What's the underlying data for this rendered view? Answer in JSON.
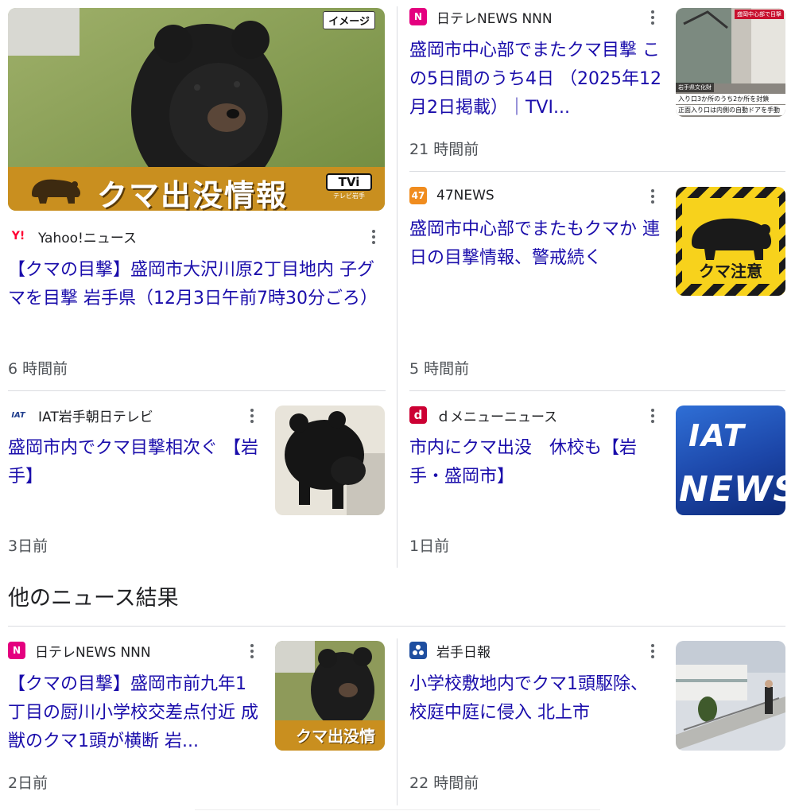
{
  "top_stories": [
    {
      "source": "Yahoo!ニュース",
      "favicon": {
        "icon": "yahoo-icon",
        "text": "Y!",
        "color": "#ff0033"
      },
      "title": "【クマの目撃】盛岡市大沢川原2丁目地内 子グマを目撃 岩手県（12月3日午前7時30分ごろ）",
      "time": "6 時間前",
      "thumb": {
        "badge": "イメージ",
        "banner": "クマ出没情報",
        "logo_top": "TVi",
        "logo_bottom": "テレビ岩手"
      }
    },
    {
      "source": "日テレNEWS NNN",
      "favicon": {
        "icon": "nnn-icon",
        "text": "N",
        "color": "#e4007f"
      },
      "title": "盛岡市中心部でまたクマ目撃 この5日間のうち4日 （2025年12月2日掲載）｜TVI...",
      "time": "21 時間前",
      "thumb": {
        "caption1": "盛岡中心部で目撃",
        "caption2": "入り口3か所のうち2か所を封鎖",
        "caption3": "正面入り口は内側の自動ドアを手動",
        "caption4": "岩手県文化財"
      }
    },
    {
      "source": "47NEWS",
      "favicon": {
        "icon": "47news-icon",
        "text": "47",
        "color": "#f08c1e"
      },
      "title": "盛岡市中心部でまたもクマか 連日の目撃情報、警戒続く",
      "time": "5 時間前",
      "thumb": {
        "sign_text": "クマ注意"
      }
    },
    {
      "source": "IAT岩手朝日テレビ",
      "favicon": {
        "icon": "iat-icon",
        "text": "IAT",
        "color": "#1e3c8c"
      },
      "title": "盛岡市内でクマ目撃相次ぐ 【岩手】",
      "time": "3日前"
    },
    {
      "source": "ｄメニューニュース",
      "favicon": {
        "icon": "dmenu-icon",
        "text": "d",
        "color": "#cc0033"
      },
      "title": "市内にクマ出没　休校も【岩手・盛岡市】",
      "time": "1日前",
      "thumb": {
        "logo": "IAT",
        "word": "NEWS"
      }
    }
  ],
  "more_news_heading": "他のニュース結果",
  "more_news": [
    {
      "source": "日テレNEWS NNN",
      "favicon": {
        "icon": "nnn-icon",
        "text": "N",
        "color": "#e4007f"
      },
      "title": "【クマの目撃】盛岡市前九年1丁目の厨川小学校交差点付近 成獣のクマ1頭が横断 岩...",
      "time": "2日前",
      "thumb": {
        "banner": "クマ出没情"
      }
    },
    {
      "source": "岩手日報",
      "favicon": {
        "icon": "iwate-nippo-icon",
        "text": "",
        "color": "#1f4fa0"
      },
      "title": "小学校敷地内でクマ1頭駆除、校庭中庭に侵入 北上市",
      "time": "22 時間前"
    }
  ]
}
